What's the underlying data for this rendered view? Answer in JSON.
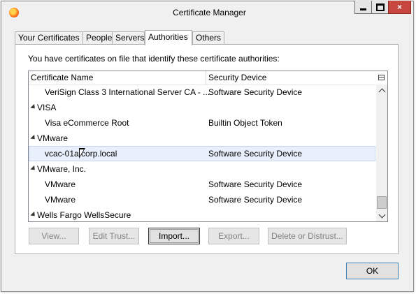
{
  "window": {
    "title": "Certificate Manager",
    "close_glyph": "×"
  },
  "tabs": [
    {
      "label": "Your Certificates",
      "active": false
    },
    {
      "label": "People",
      "active": false
    },
    {
      "label": "Servers",
      "active": false
    },
    {
      "label": "Authorities",
      "active": true
    },
    {
      "label": "Others",
      "active": false
    }
  ],
  "intro_text": "You have certificates on file that identify these certificate authorities:",
  "tree": {
    "columns": [
      "Certificate Name",
      "Security Device"
    ],
    "rows": [
      {
        "type": "child",
        "name": "VeriSign Class 3 International Server CA - ...",
        "device": "Software Security Device"
      },
      {
        "type": "group",
        "name": "VISA",
        "device": ""
      },
      {
        "type": "child",
        "name": "Visa eCommerce Root",
        "device": "Builtin Object Token"
      },
      {
        "type": "group",
        "name": "VMware",
        "device": ""
      },
      {
        "type": "child",
        "name": "vcac-01a.corp.local",
        "device": "Software Security Device",
        "selected": true
      },
      {
        "type": "group",
        "name": "VMware, Inc.",
        "device": ""
      },
      {
        "type": "child",
        "name": "VMware",
        "device": "Software Security Device"
      },
      {
        "type": "child",
        "name": "VMware",
        "device": "Software Security Device"
      },
      {
        "type": "group",
        "name": "Wells Fargo WellsSecure",
        "device": ""
      }
    ]
  },
  "buttons": {
    "view": "View...",
    "edit_trust": "Edit Trust...",
    "import": "Import...",
    "export": "Export...",
    "delete": "Delete or Distrust...",
    "ok": "OK"
  },
  "colors": {
    "selected_row": "#e8f0fb",
    "close_button": "#c7463d"
  }
}
